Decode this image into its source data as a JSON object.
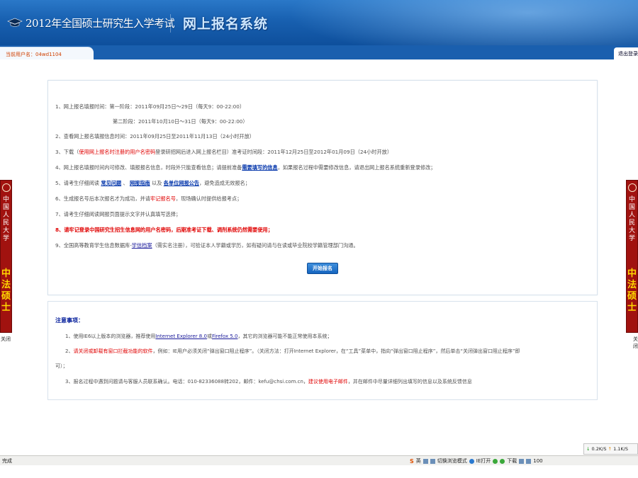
{
  "header": {
    "exam_title": "2012年全国硕士研究生入学考试",
    "system_title": "网上报名系统"
  },
  "userbar": {
    "current_user_label": "当前用户名：04wd1104",
    "logout_label": "退出登录"
  },
  "ribbon": {
    "university": "中国人民大学",
    "program": "中法硕士",
    "close_label": "关闭"
  },
  "info": {
    "l1a": "1、网上报名填报时间：第一阶段：2011年09月25日～29日（每天9：00-22:00）",
    "l1b": "第二阶段：2011年10月10日～31日（每天9：00-22:00）",
    "l2": "2、查看网上报名填报信息时间：2011年09月25日至2011年11月13日（24小时开放）",
    "l3_pre": "3、下载（",
    "l3_red": "使用网上报名时注册的用户名密码",
    "l3_post": "登录研招网后进入网上报名栏目）准考证时间段：2011年12月25日至2012年01月09日（24小时开放）",
    "l4_pre": "4、网上报名填报时间内可修改、填报报名信息，时段外只能查看信息；请提前准备",
    "l4_link": "需要填写的信息",
    "l4_post": "，如果报名过程中需要修改信息，请退出网上报名系统重新登录修改；",
    "l5_pre": "5、请考生仔细阅读",
    "l5_link1": "常见问题",
    "l5_sep1": "、",
    "l5_link2": "网报指南",
    "l5_sep2": "以及",
    "l5_link3": "各单位网报公告",
    "l5_post": "，避免造成无效报名；",
    "l6_pre": "6、生成报名号后本次报名才为成功，并请",
    "l6_red": "牢记报名号",
    "l6_post": "，现场确认时提供给报考点；",
    "l7": "7、请考生仔细阅读网报页面提示文字并认真填写选择；",
    "l8": "8、请牢记登录中国研究生招生信息网的用户名密码，后期准考证下载、调剂系统仍然需要使用；",
    "l9_pre": "9、全国高等教育学生信息数据库-",
    "l9_link": "学信档案",
    "l9_post": "（需实名注册），可验证本人学籍或学历，如有疑问请与在读或毕业院校学籍管理部门沟通。",
    "start_button": "开始报名"
  },
  "notes": {
    "title": "注意事项：",
    "n1_pre": "1、使用IE6以上版本的浏览器，推荐使用",
    "n1_link1": "Internet Explorer 8.0",
    "n1_or": "或",
    "n1_link2": "Firefox 5.0",
    "n1_post": "，其它的浏览器可能不能正常使用本系统；",
    "n2_pre": "2、",
    "n2_red": "请关闭或卸载有窗口拦截功能的软件",
    "n2_post": "，例如：IE用户必须关闭“弹出窗口阻止程序”。（关闭方法：打开Internet Explorer，在“工具”菜单中，指向“弹出窗口阻止程序”，然后单击“关闭弹出窗口阻止程序”即",
    "n2_cont": "可）；",
    "n3_pre": "3、报名过程中遇到问题请与客服人员联系确认。电话：010-82336088转202，邮件：kefu@chsi.com.cn，",
    "n3_red": "建议使用电子邮件",
    "n3_post": "，并在邮件中尽量详细列出填写的信息以及系统反馈信息"
  },
  "statusbar": {
    "done": "完成",
    "ime": "英",
    "mode": "切换浏览模式",
    "ie": "IE打开",
    "download": "下载",
    "zoom": "100"
  },
  "speed": {
    "down": "0.2K/S",
    "up": "1.1K/S"
  },
  "colors": {
    "banner": "#1860b0",
    "ribbon": "#a1120f",
    "link": "#0033aa",
    "warning": "#e00000"
  }
}
